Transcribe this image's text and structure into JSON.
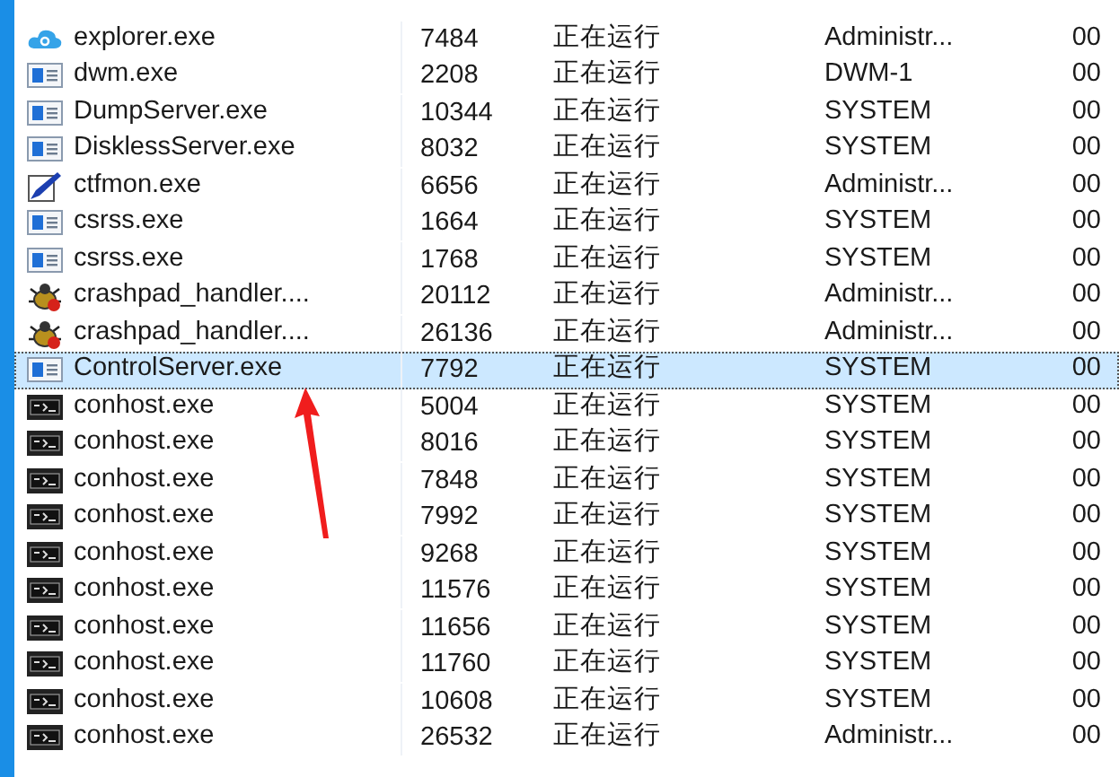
{
  "rows": [
    {
      "kind": "cloud",
      "name": "explorer.exe",
      "pid": "7484",
      "status": "正在运行",
      "user": "Administr...",
      "cpu": "00",
      "selected": false
    },
    {
      "kind": "window",
      "name": "dwm.exe",
      "pid": "2208",
      "status": "正在运行",
      "user": "DWM-1",
      "cpu": "00",
      "selected": false
    },
    {
      "kind": "window",
      "name": "DumpServer.exe",
      "pid": "10344",
      "status": "正在运行",
      "user": "SYSTEM",
      "cpu": "00",
      "selected": false
    },
    {
      "kind": "window",
      "name": "DisklessServer.exe",
      "pid": "8032",
      "status": "正在运行",
      "user": "SYSTEM",
      "cpu": "00",
      "selected": false
    },
    {
      "kind": "pen",
      "name": "ctfmon.exe",
      "pid": "6656",
      "status": "正在运行",
      "user": "Administr...",
      "cpu": "00",
      "selected": false
    },
    {
      "kind": "window",
      "name": "csrss.exe",
      "pid": "1664",
      "status": "正在运行",
      "user": "SYSTEM",
      "cpu": "00",
      "selected": false
    },
    {
      "kind": "window",
      "name": "csrss.exe",
      "pid": "1768",
      "status": "正在运行",
      "user": "SYSTEM",
      "cpu": "00",
      "selected": false
    },
    {
      "kind": "bug",
      "name": "crashpad_handler....",
      "pid": "20112",
      "status": "正在运行",
      "user": "Administr...",
      "cpu": "00",
      "selected": false
    },
    {
      "kind": "bug",
      "name": "crashpad_handler....",
      "pid": "26136",
      "status": "正在运行",
      "user": "Administr...",
      "cpu": "00",
      "selected": false
    },
    {
      "kind": "window",
      "name": "ControlServer.exe",
      "pid": "7792",
      "status": "正在运行",
      "user": "SYSTEM",
      "cpu": "00",
      "selected": true
    },
    {
      "kind": "console",
      "name": "conhost.exe",
      "pid": "5004",
      "status": "正在运行",
      "user": "SYSTEM",
      "cpu": "00",
      "selected": false
    },
    {
      "kind": "console",
      "name": "conhost.exe",
      "pid": "8016",
      "status": "正在运行",
      "user": "SYSTEM",
      "cpu": "00",
      "selected": false
    },
    {
      "kind": "console",
      "name": "conhost.exe",
      "pid": "7848",
      "status": "正在运行",
      "user": "SYSTEM",
      "cpu": "00",
      "selected": false
    },
    {
      "kind": "console",
      "name": "conhost.exe",
      "pid": "7992",
      "status": "正在运行",
      "user": "SYSTEM",
      "cpu": "00",
      "selected": false
    },
    {
      "kind": "console",
      "name": "conhost.exe",
      "pid": "9268",
      "status": "正在运行",
      "user": "SYSTEM",
      "cpu": "00",
      "selected": false
    },
    {
      "kind": "console",
      "name": "conhost.exe",
      "pid": "11576",
      "status": "正在运行",
      "user": "SYSTEM",
      "cpu": "00",
      "selected": false
    },
    {
      "kind": "console",
      "name": "conhost.exe",
      "pid": "11656",
      "status": "正在运行",
      "user": "SYSTEM",
      "cpu": "00",
      "selected": false
    },
    {
      "kind": "console",
      "name": "conhost.exe",
      "pid": "11760",
      "status": "正在运行",
      "user": "SYSTEM",
      "cpu": "00",
      "selected": false
    },
    {
      "kind": "console",
      "name": "conhost.exe",
      "pid": "10608",
      "status": "正在运行",
      "user": "SYSTEM",
      "cpu": "00",
      "selected": false
    },
    {
      "kind": "console",
      "name": "conhost.exe",
      "pid": "26532",
      "status": "正在运行",
      "user": "Administr...",
      "cpu": "00",
      "selected": false
    }
  ]
}
